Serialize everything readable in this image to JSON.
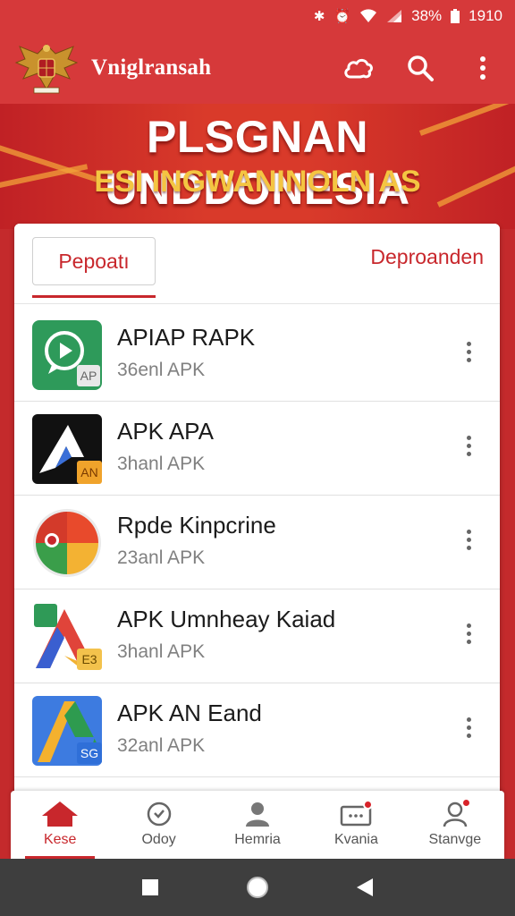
{
  "status_bar": {
    "icons": [
      "bluetooth-icon",
      "alarm-icon",
      "wifi-icon",
      "signal-icon",
      "battery-icon"
    ],
    "battery": "38%",
    "time": "1910"
  },
  "app_bar": {
    "title": "Vniglransah",
    "actions": [
      "cloud-icon",
      "search-icon",
      "more-vert-icon"
    ]
  },
  "hero": {
    "title": "PLSGNAN UNDDONESIA",
    "subtitle": "ESI INGWANINOLN AS"
  },
  "tabs": {
    "active": "Pepoatı",
    "other": "Deproanden"
  },
  "apps": [
    {
      "title": "APIAP RAPK",
      "subtitle": "36enl APK",
      "badge": "AP"
    },
    {
      "title": "APK APA",
      "subtitle": "3hanl APK",
      "badge": "AN"
    },
    {
      "title": "Rpde Kinpcrine",
      "subtitle": "23anl APK",
      "badge": ""
    },
    {
      "title": "APK Umnheay Kaiad",
      "subtitle": "3hanl APK",
      "badge": "E3"
    },
    {
      "title": "APK AN Eand",
      "subtitle": "32anl APK",
      "badge": "SG"
    }
  ],
  "bottom_nav": [
    {
      "label": "Kese",
      "icon": "home-icon",
      "active": true
    },
    {
      "label": "Odoy",
      "icon": "clock-icon",
      "active": false
    },
    {
      "label": "Hemria",
      "icon": "person-icon",
      "active": false
    },
    {
      "label": "Kvania",
      "icon": "inbox-icon",
      "active": false
    },
    {
      "label": "Stanvge",
      "icon": "profile-icon",
      "active": false
    }
  ],
  "colors": {
    "primary": "#d6393a",
    "accent": "#c8272c",
    "gold": "#f4c542"
  }
}
